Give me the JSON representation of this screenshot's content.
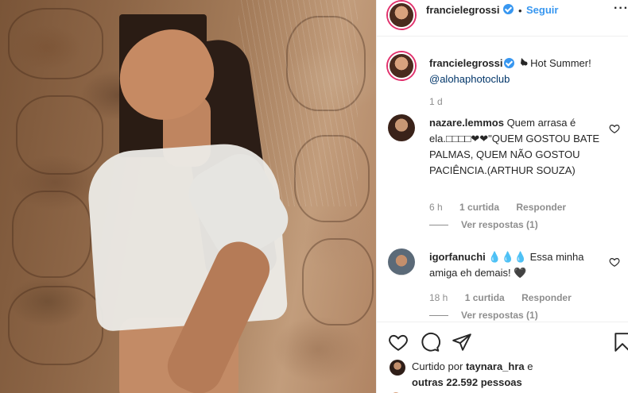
{
  "post": {
    "username": "francielegrossi",
    "follow_label": "Seguir",
    "dot": "•",
    "more": "···"
  },
  "caption": {
    "username": "francielegrossi",
    "text": "Hot Summer!",
    "mention": "@alohaphotoclub",
    "time": "1 d"
  },
  "comments": [
    {
      "username": "nazare.lemmos",
      "text": "Quem arrasa é ela.□□□□❤❤\"QUEM GOSTOU BATE PALMAS, QUEM NÃO GOSTOU PACIÊNCIA.(ARTHUR SOUZA)",
      "time": "6 h",
      "likes": "1 curtida",
      "reply": "Responder",
      "view_replies": "Ver respostas (1)"
    },
    {
      "username": "igorfanuchi",
      "text": "💧💧💧 Essa minha amiga eh demais! 🖤",
      "time": "18 h",
      "likes": "1 curtida",
      "reply": "Responder",
      "view_replies": "Ver respostas (1)"
    }
  ],
  "likes": {
    "prefix": "Curtido por",
    "user": "taynara_hra",
    "and": "e",
    "others": "outras 22.592 pessoas"
  },
  "icons": [
    "heart-icon",
    "comment-icon",
    "share-icon",
    "bookmark-icon",
    "verified-icon",
    "more-icon"
  ],
  "colors": {
    "link": "#3897f0",
    "text": "#262626",
    "muted": "#8e8e8e",
    "mention": "#003569"
  }
}
